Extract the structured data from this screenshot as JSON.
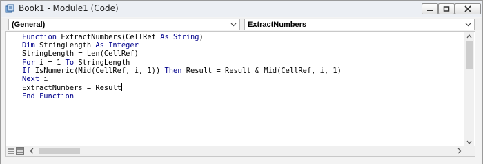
{
  "window": {
    "title": "Book1 - Module1 (Code)",
    "buttons": {
      "minimize": "minimize",
      "restore": "restore",
      "close": "close"
    }
  },
  "combos": {
    "object": "(General)",
    "procedure": "ExtractNumbers"
  },
  "code": {
    "lines": [
      [
        {
          "t": "Function ",
          "k": true
        },
        {
          "t": "ExtractNumbers(CellRef ",
          "k": false
        },
        {
          "t": "As String",
          "k": true
        },
        {
          "t": ")",
          "k": false
        }
      ],
      [
        {
          "t": "Dim ",
          "k": true
        },
        {
          "t": "StringLength ",
          "k": false
        },
        {
          "t": "As Integer",
          "k": true
        }
      ],
      [
        {
          "t": "StringLength = Len(CellRef)",
          "k": false
        }
      ],
      [
        {
          "t": "For ",
          "k": true
        },
        {
          "t": "i = 1 ",
          "k": false
        },
        {
          "t": "To ",
          "k": true
        },
        {
          "t": "StringLength",
          "k": false
        }
      ],
      [
        {
          "t": "If ",
          "k": true
        },
        {
          "t": "IsNumeric(Mid(CellRef, i, 1)) ",
          "k": false
        },
        {
          "t": "Then ",
          "k": true
        },
        {
          "t": "Result = Result & Mid(CellRef, i, 1)",
          "k": false
        }
      ],
      [
        {
          "t": "Next ",
          "k": true
        },
        {
          "t": "i",
          "k": false
        }
      ],
      [
        {
          "t": "ExtractNumbers = Result",
          "k": false
        }
      ],
      [
        {
          "t": "End Function",
          "k": true
        }
      ]
    ],
    "caret_line": 6
  },
  "colors": {
    "keyword": "#00008b",
    "text": "#000000",
    "background": "#ffffff"
  }
}
